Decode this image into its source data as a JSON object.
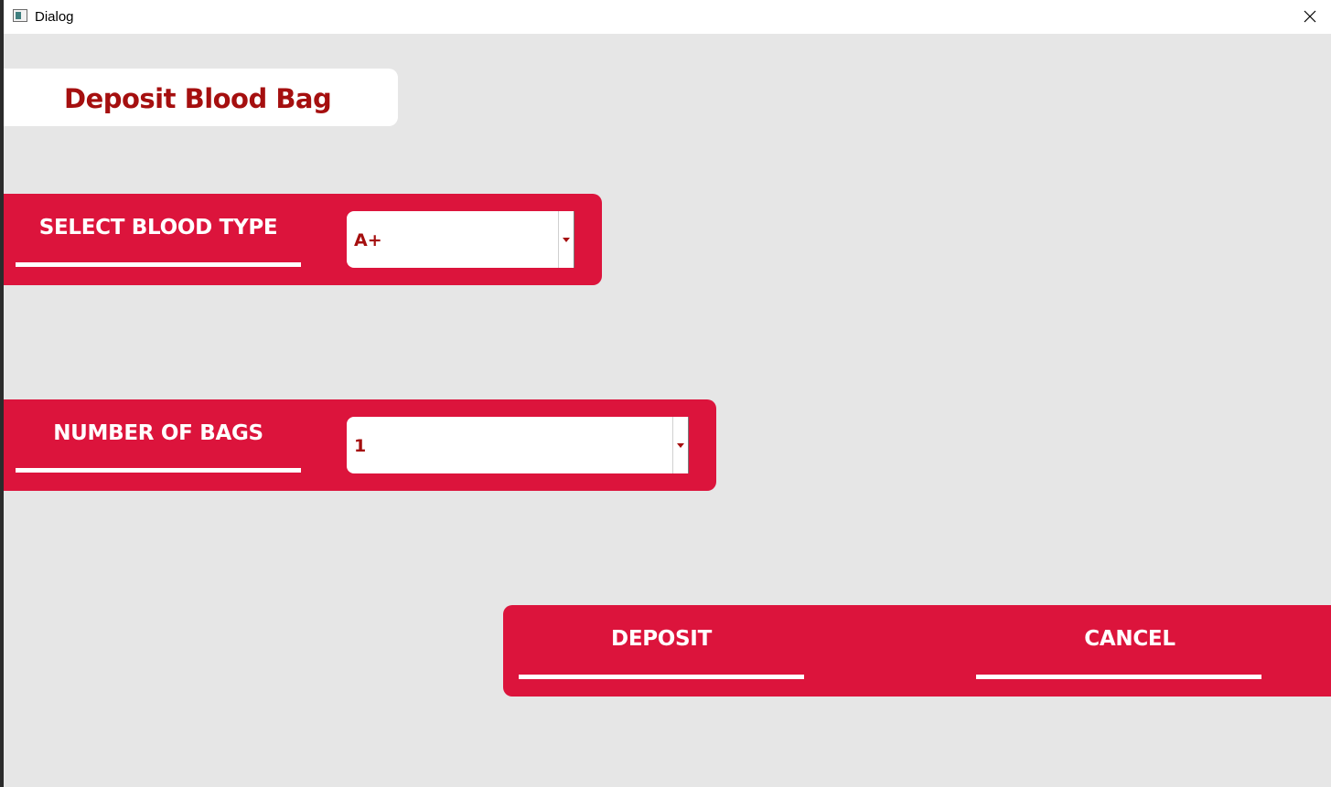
{
  "window": {
    "title": "Dialog",
    "icon": "app-window-icon",
    "close_icon": "close-icon"
  },
  "heading": {
    "text": "Deposit Blood Bag",
    "color": "#a50f0f"
  },
  "blood_type": {
    "label": "SELECT BLOOD TYPE",
    "selected": "A+"
  },
  "bags": {
    "label": "NUMBER OF BAGS",
    "selected": "1"
  },
  "actions": {
    "deposit_label": "DEPOSIT",
    "cancel_label": "CANCEL"
  },
  "colors": {
    "accent": "#dc143c",
    "text_dark_red": "#a50f0f",
    "background": "#e6e6e6"
  }
}
